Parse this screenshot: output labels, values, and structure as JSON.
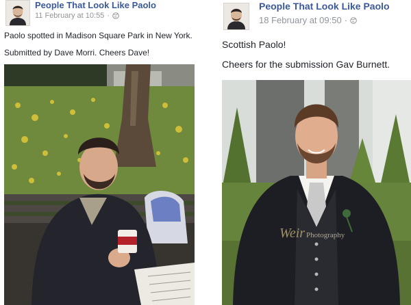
{
  "posts": [
    {
      "page_name": "People That Look Like Paolo",
      "timestamp": "11 February at 10:55",
      "separator": "·",
      "privacy_icon": "globe-icon",
      "caption_lines": [
        "Paolo spotted in Madison Square Park in New York.",
        "Submitted by Dave Morri. Cheers Dave!"
      ]
    },
    {
      "page_name": "People That Look Like Paolo",
      "timestamp": "18 February at 09:50",
      "separator": "·",
      "privacy_icon": "globe-icon",
      "caption_lines": [
        "Scottish Paolo!",
        "Cheers for the submission Gav Burnett."
      ],
      "watermark": "Weir",
      "watermark_sub": "Photography"
    }
  ],
  "colors": {
    "link": "#3b5998",
    "meta": "#90949c",
    "text": "#1d2129"
  }
}
